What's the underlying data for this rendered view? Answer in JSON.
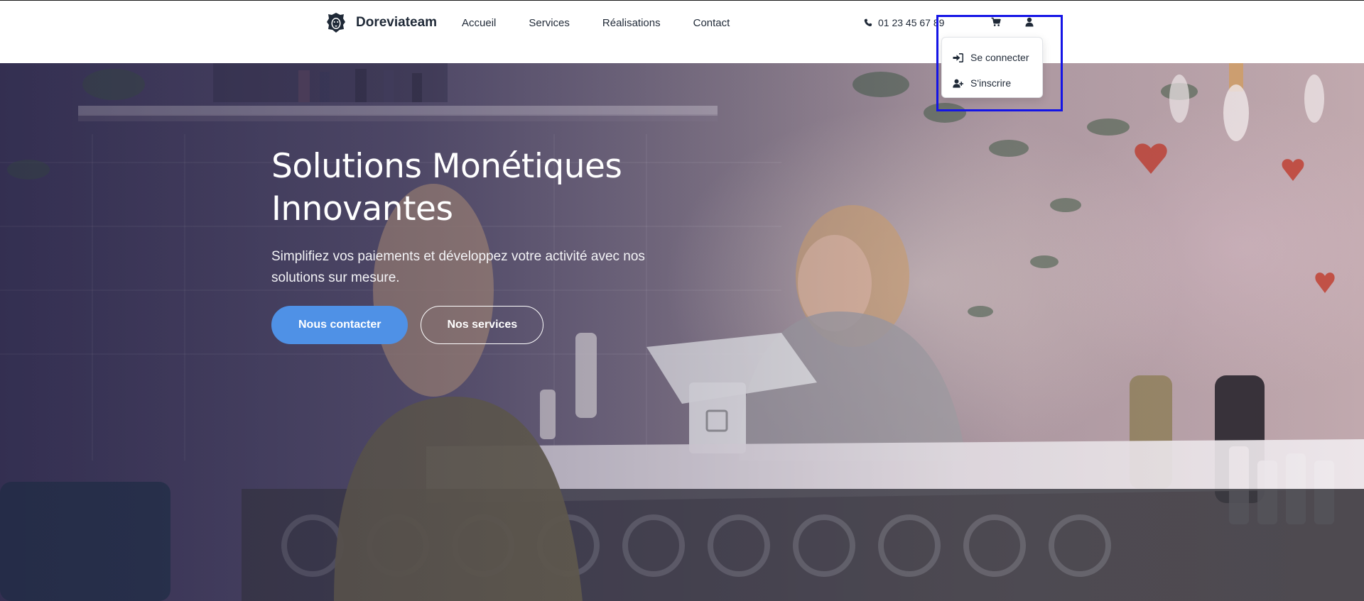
{
  "header": {
    "brand_name": "Doreviateam",
    "nav": [
      {
        "label": "Accueil"
      },
      {
        "label": "Services"
      },
      {
        "label": "Réalisations"
      },
      {
        "label": "Contact"
      }
    ],
    "phone": "01 23 45 67 89",
    "icons": {
      "phone": "phone-icon",
      "cart": "shopping-cart-icon",
      "user": "user-icon",
      "logo": "lion-logo-icon"
    }
  },
  "user_dropdown": {
    "items": [
      {
        "label": "Se connecter",
        "icon": "sign-in-icon"
      },
      {
        "label": "S'inscrire",
        "icon": "user-plus-icon"
      }
    ]
  },
  "hero": {
    "title_line1": "Solutions Monétiques",
    "title_line2": "Innovantes",
    "subtitle": "Simplifiez vos paiements et développez votre activité avec nos solutions sur mesure.",
    "primary_button": "Nous contacter",
    "secondary_button": "Nos services"
  },
  "colors": {
    "accent": "#4f91e6",
    "text_dark": "#1f2937",
    "focus_frame": "#1414e6"
  }
}
